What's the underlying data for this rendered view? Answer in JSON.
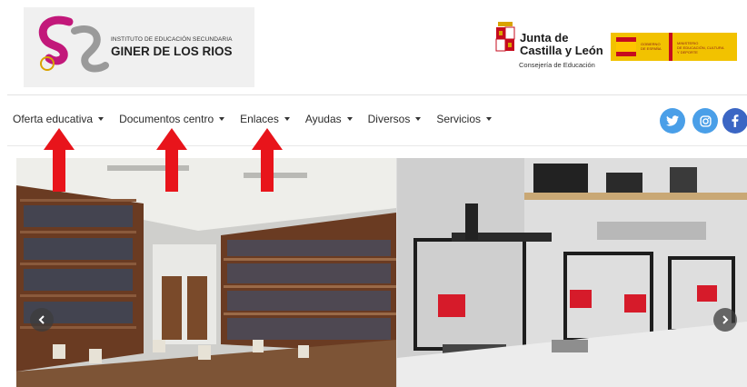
{
  "header": {
    "school_subtitle": "INSTITUTO DE EDUCACIÓN SECUNDARIA",
    "school_name": "GINER DE LOS RIOS",
    "jcyl_line1": "Junta de",
    "jcyl_line2": "Castilla y León",
    "jcyl_sub": "Consejería de Educación",
    "gob_left": "GOBIERNO\nDE ESPAÑA",
    "gob_right": "MINISTERIO\nDE EDUCACIÓN, CULTURA\nY DEPORTE"
  },
  "nav": {
    "items": [
      {
        "label": "Oferta educativa"
      },
      {
        "label": "Documentos centro"
      },
      {
        "label": "Enlaces"
      },
      {
        "label": "Ayudas"
      },
      {
        "label": "Diversos"
      },
      {
        "label": "Servicios"
      }
    ]
  },
  "social": {
    "twitter_icon": "twitter-icon",
    "instagram_icon": "instagram-icon",
    "facebook_icon": "facebook-icon"
  },
  "colors": {
    "arrow_red": "#e8141b",
    "social_blue": "#4a9fe8",
    "facebook_blue": "#3b66c4",
    "logo_magenta": "#c2187a"
  },
  "slider": {
    "prev_icon": "chevron-left-icon",
    "next_icon": "chevron-right-icon"
  }
}
